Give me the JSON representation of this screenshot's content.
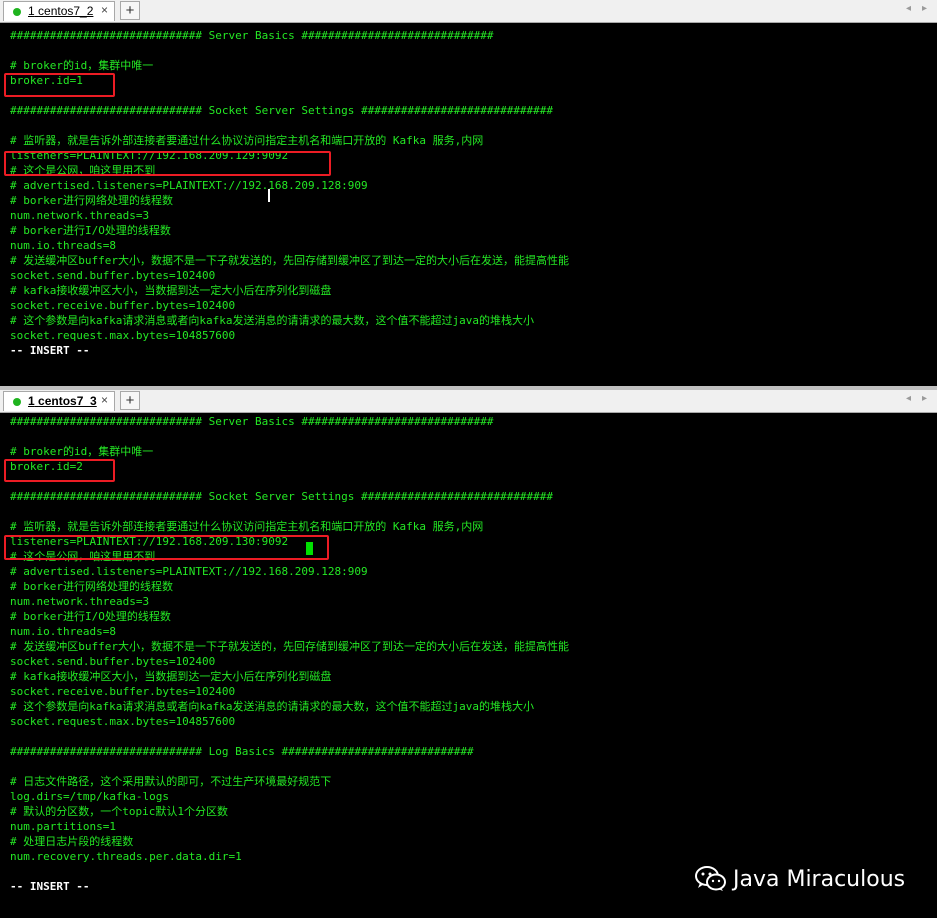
{
  "top_tab": {
    "number": "1",
    "title": "centos7_2",
    "close": "×"
  },
  "bottom_tab": {
    "number": "1",
    "title": "centos7_3",
    "close": "×"
  },
  "tab_add": "+",
  "nav": {
    "left": "◂",
    "right": "▸"
  },
  "top_lines": [
    "############################# Server Basics #############################",
    "",
    "# broker的id，集群中唯一",
    "broker.id=1",
    "",
    "############################# Socket Server Settings #############################",
    "",
    "# 监听器，就是告诉外部连接者要通过什么协议访问指定主机名和端口开放的 Kafka 服务,内网",
    "listeners=PLAINTEXT://192.168.209.129:9092",
    "# 这个是公网，咱这里用不到",
    "# advertised.listeners=PLAINTEXT://192.168.209.128:909",
    "# borker进行网络处理的线程数",
    "num.network.threads=3",
    "# borker进行I/O处理的线程数",
    "num.io.threads=8",
    "# 发送缓冲区buffer大小，数据不是一下子就发送的，先回存储到缓冲区了到达一定的大小后在发送，能提高性能",
    "socket.send.buffer.bytes=102400",
    "# kafka接收缓冲区大小，当数据到达一定大小后在序列化到磁盘",
    "socket.receive.buffer.bytes=102400",
    "# 这个参数是向kafka请求消息或者向kafka发送消息的请请求的最大数，这个值不能超过java的堆栈大小",
    "socket.request.max.bytes=104857600",
    "-- INSERT --"
  ],
  "bottom_lines": [
    "############################# Server Basics #############################",
    "",
    "# broker的id，集群中唯一",
    "broker.id=2",
    "",
    "############################# Socket Server Settings #############################",
    "",
    "# 监听器，就是告诉外部连接者要通过什么协议访问指定主机名和端口开放的 Kafka 服务,内网",
    "listeners=PLAINTEXT://192.168.209.130:9092",
    "# 这个是公网，咱这里用不到",
    "# advertised.listeners=PLAINTEXT://192.168.209.128:909",
    "# borker进行网络处理的线程数",
    "num.network.threads=3",
    "# borker进行I/O处理的线程数",
    "num.io.threads=8",
    "# 发送缓冲区buffer大小，数据不是一下子就发送的，先回存储到缓冲区了到达一定的大小后在发送，能提高性能",
    "socket.send.buffer.bytes=102400",
    "# kafka接收缓冲区大小，当数据到达一定大小后在序列化到磁盘",
    "socket.receive.buffer.bytes=102400",
    "# 这个参数是向kafka请求消息或者向kafka发送消息的请请求的最大数，这个值不能超过java的堆栈大小",
    "socket.request.max.bytes=104857600",
    "",
    "############################# Log Basics #############################",
    "",
    "# 日志文件路径，这个采用默认的即可，不过生产环境最好规范下",
    "log.dirs=/tmp/kafka-logs",
    "# 默认的分区数，一个topic默认1个分区数",
    "num.partitions=1",
    "# 处理日志片段的线程数",
    "num.recovery.threads.per.data.dir=1",
    "",
    "-- INSERT --"
  ],
  "watermark": {
    "text": "Java Miraculous",
    "icon": "wechat-icon"
  },
  "colors": {
    "text": "#24e824",
    "highlight": "#ec1c24",
    "background": "#000000",
    "tab_dot": "#1fb31f"
  }
}
